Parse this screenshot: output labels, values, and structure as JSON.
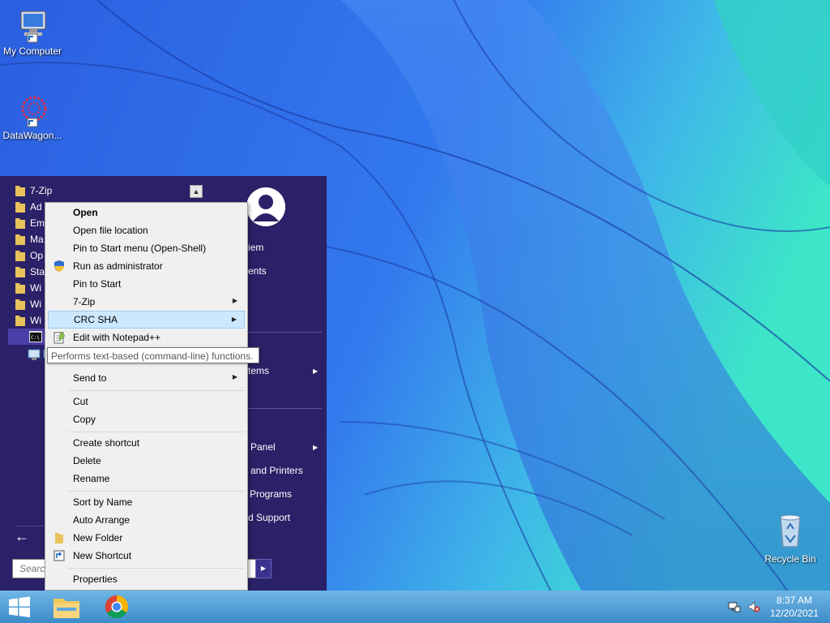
{
  "desktop": {
    "icons": [
      {
        "label": "My Computer",
        "icon": "computer-icon"
      },
      {
        "label": "DataWagon...",
        "icon": "datawagon-icon"
      },
      {
        "label": "Recycle Bin",
        "icon": "recycle-bin-icon"
      }
    ]
  },
  "start_menu": {
    "programs": [
      {
        "label": "7-Zip",
        "icon": "folder-icon"
      },
      {
        "label": "Ad",
        "icon": "folder-icon"
      },
      {
        "label": "Em",
        "icon": "folder-icon"
      },
      {
        "label": "Ma",
        "icon": "folder-icon"
      },
      {
        "label": "Op",
        "icon": "folder-icon"
      },
      {
        "label": "Sta",
        "icon": "folder-icon"
      },
      {
        "label": "Wi",
        "icon": "folder-icon"
      },
      {
        "label": "Wi",
        "icon": "folder-icon"
      },
      {
        "label": "Wi",
        "icon": "folder-icon"
      }
    ],
    "right_items": [
      "iem",
      "ents",
      "tems",
      "Panel",
      "and Printers",
      "Programs",
      "d Support"
    ],
    "back_glyph": "←",
    "search_placeholder": "Search"
  },
  "context_menu": {
    "items": [
      {
        "label": "Open",
        "bold": true
      },
      {
        "label": "Open file location"
      },
      {
        "label": "Pin to Start menu (Open-Shell)"
      },
      {
        "label": "Run as administrator",
        "icon": "shield-icon"
      },
      {
        "label": "Pin to Start"
      },
      {
        "label": "7-Zip",
        "submenu": true
      },
      {
        "label": "CRC SHA",
        "submenu": true,
        "highlighted": true
      },
      {
        "label": "Edit with Notepad++",
        "icon": "notepadpp-icon"
      },
      {
        "label": "Send to",
        "submenu": true
      },
      {
        "label": "Cut"
      },
      {
        "label": "Copy"
      },
      {
        "label": "Create shortcut"
      },
      {
        "label": "Delete"
      },
      {
        "label": "Rename"
      },
      {
        "label": "Sort by Name"
      },
      {
        "label": "Auto Arrange"
      },
      {
        "label": "New Folder",
        "icon": "folder-icon"
      },
      {
        "label": "New Shortcut",
        "icon": "shortcut-icon"
      },
      {
        "label": "Properties"
      }
    ]
  },
  "tooltip": "Performs text-based (command-line) functions.",
  "taskbar": {
    "apps": [
      "file-explorer-icon",
      "chrome-icon"
    ],
    "tray": [
      "network-icon",
      "volume-muted-icon"
    ],
    "time": "8:37 AM",
    "date": "12/20/2021"
  },
  "colors": {
    "start_menu_bg": "#2a2168",
    "context_highlight": "#cce8ff",
    "taskbar": "#4d9fd6"
  }
}
